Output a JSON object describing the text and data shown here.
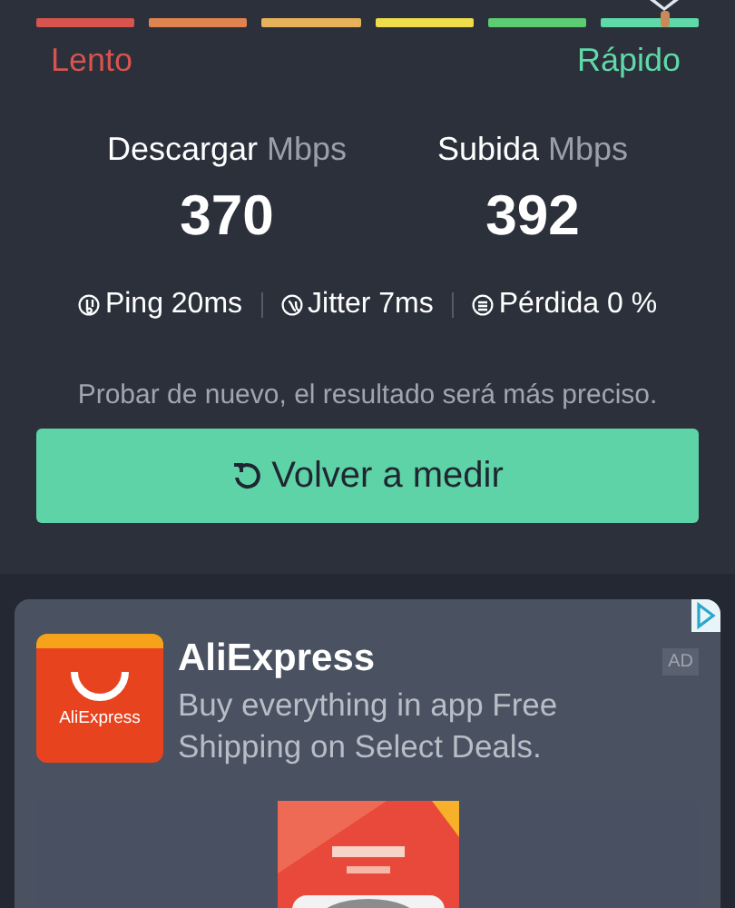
{
  "speed_scale": {
    "segments": [
      {
        "color": "#d9534f"
      },
      {
        "color": "#e0834f"
      },
      {
        "color": "#e8b25a"
      },
      {
        "color": "#eedc4a"
      },
      {
        "color": "#5ccc73"
      },
      {
        "color": "#5fd9a8"
      }
    ],
    "slow_label": "Lento",
    "fast_label": "Rápido"
  },
  "results": [
    {
      "label": "Descargar",
      "unit": "Mbps",
      "value": "370"
    },
    {
      "label": "Subida",
      "unit": "Mbps",
      "value": "392"
    }
  ],
  "stats": [
    {
      "kind": "ping",
      "text": "Ping 20ms"
    },
    {
      "kind": "jitter",
      "text": "Jitter 7ms"
    },
    {
      "kind": "loss",
      "text": "Pérdida 0 %"
    }
  ],
  "hint": "Probar de nuevo, el resultado será más preciso.",
  "retest_button": "Volver a medir",
  "ad": {
    "logo_text": "AliExpress",
    "title": "AliExpress",
    "description": "Buy everything in app Free Shipping on Select Deals.",
    "badge": "AD"
  }
}
